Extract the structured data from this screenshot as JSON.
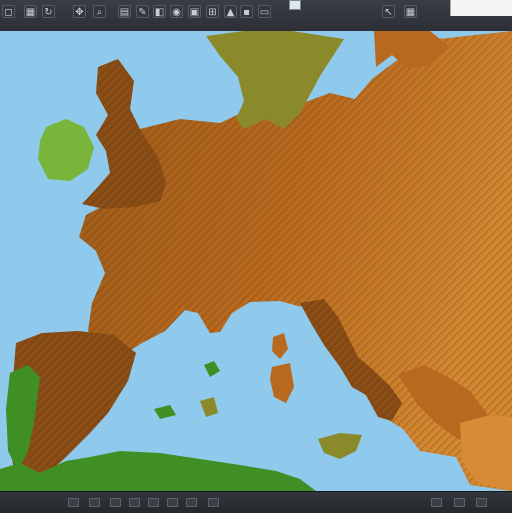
{
  "toolbar": {
    "buttons": [
      {
        "icon": "select-icon",
        "glyph": "◻"
      },
      {
        "icon": "grid-icon",
        "glyph": "▦"
      },
      {
        "icon": "refresh-icon",
        "glyph": "↻"
      },
      {
        "icon": "pan-icon",
        "glyph": "✥"
      },
      {
        "icon": "zoom-icon",
        "glyph": "⌕"
      },
      {
        "icon": "layer-icon",
        "glyph": "▤"
      },
      {
        "icon": "brush-icon",
        "glyph": "✎"
      },
      {
        "icon": "fill-icon",
        "glyph": "◧"
      },
      {
        "icon": "eye-icon",
        "glyph": "◉"
      },
      {
        "icon": "image-icon",
        "glyph": "▣"
      },
      {
        "icon": "grid-alt-icon",
        "glyph": "⊞"
      },
      {
        "icon": "terrain-icon",
        "glyph": "▲"
      },
      {
        "icon": "lock-icon",
        "glyph": "▪"
      },
      {
        "icon": "window-icon",
        "glyph": "▭"
      },
      {
        "icon": "cursor-icon",
        "glyph": "↖"
      },
      {
        "icon": "tile-icon",
        "glyph": "▦"
      }
    ]
  },
  "colors": {
    "sea": "#8fc9ec",
    "land_dark": "#8a4d16",
    "land_mid": "#b9691f",
    "land_light": "#d88a34",
    "forest": "#3f8f24",
    "forest_light": "#79b53a",
    "olive": "#8b8a2a"
  },
  "map": {
    "region": "Europe"
  }
}
